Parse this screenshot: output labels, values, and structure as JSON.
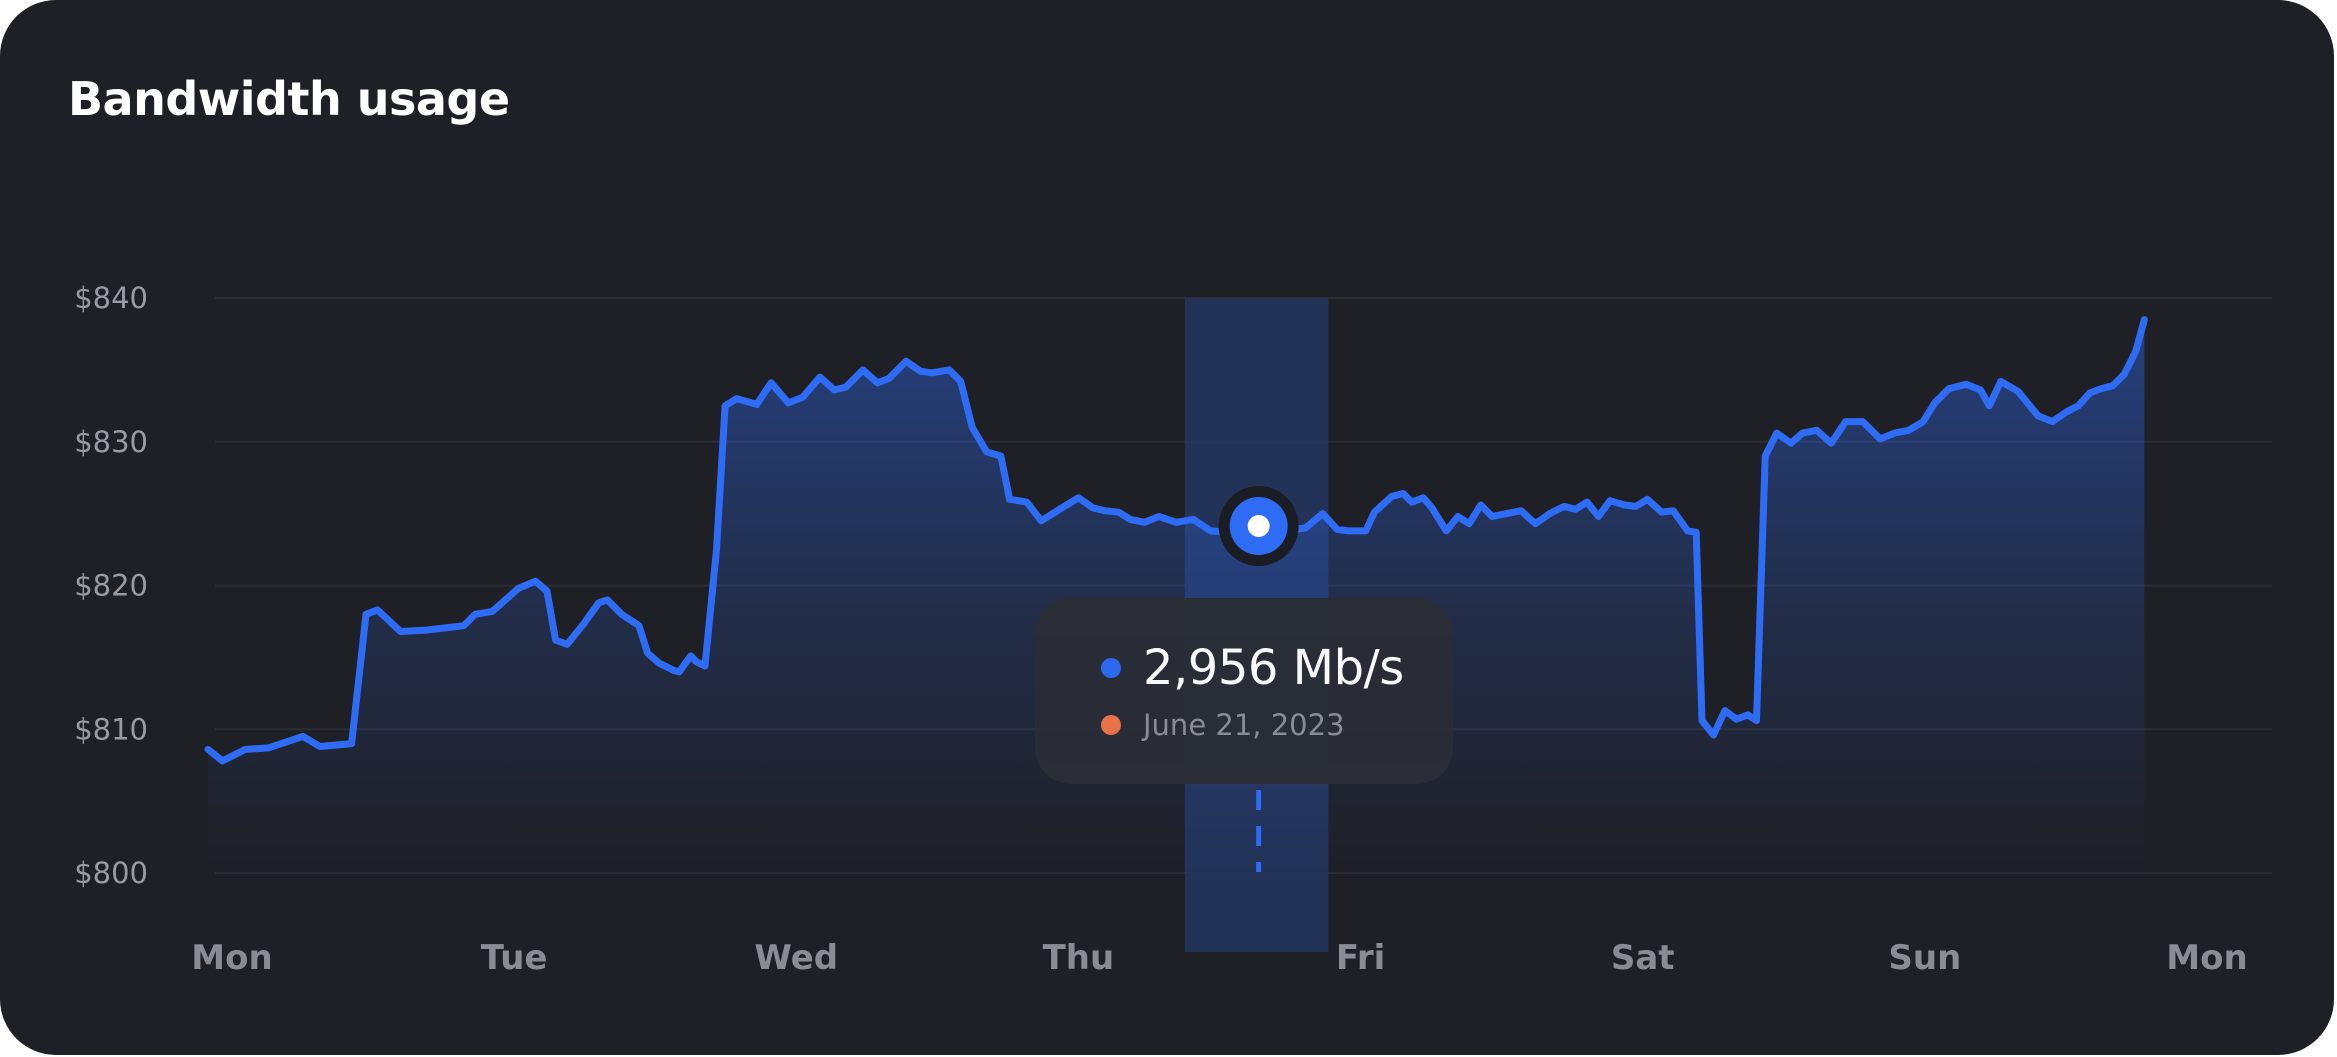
{
  "title": "Bandwidth usage",
  "colors": {
    "background": "#1f2026",
    "line": "#2e6cf6",
    "highlight_band": "#23355e",
    "grid": "#2b2d34",
    "tooltip_value_dot": "#2e6cf6",
    "tooltip_date_dot": "#f0744a"
  },
  "tooltip": {
    "value": "2,956 Mb/s",
    "date": "June 21, 2023"
  },
  "chart_data": {
    "type": "area",
    "title": "Bandwidth usage",
    "y_tick_labels": [
      "$840",
      "$830",
      "$820",
      "$810",
      "$800"
    ],
    "y_ticks": [
      840,
      830,
      820,
      810,
      800
    ],
    "ylim": [
      800,
      840
    ],
    "x_tick_labels": [
      "Mon",
      "Tue",
      "Wed",
      "Thu",
      "Fri",
      "Sat",
      "Sun",
      "Mon"
    ],
    "xlim": [
      0,
      7.2
    ],
    "grid": true,
    "highlight": {
      "x_range": [
        3.4,
        3.9
      ],
      "marker": {
        "x": 3.65,
        "y": 824.2
      }
    },
    "series": [
      {
        "values": [
          [
            0,
            808.6
          ],
          [
            0.05,
            807.8
          ],
          [
            0.13,
            808.6
          ],
          [
            0.21,
            808.7
          ],
          [
            0.33,
            809.5
          ],
          [
            0.39,
            808.8
          ],
          [
            0.5,
            809.0
          ],
          [
            0.55,
            818.0
          ],
          [
            0.59,
            818.3
          ],
          [
            0.67,
            816.8
          ],
          [
            0.76,
            816.9
          ],
          [
            0.89,
            817.2
          ],
          [
            0.93,
            818.0
          ],
          [
            0.99,
            818.2
          ],
          [
            1.08,
            819.8
          ],
          [
            1.14,
            820.3
          ],
          [
            1.18,
            819.6
          ],
          [
            1.21,
            816.2
          ],
          [
            1.25,
            815.9
          ],
          [
            1.31,
            817.4
          ],
          [
            1.36,
            818.8
          ],
          [
            1.39,
            819.0
          ],
          [
            1.44,
            818.0
          ],
          [
            1.5,
            817.2
          ],
          [
            1.53,
            815.3
          ],
          [
            1.57,
            814.6
          ],
          [
            1.62,
            814.1
          ],
          [
            1.64,
            814.0
          ],
          [
            1.68,
            815.1
          ],
          [
            1.7,
            814.7
          ],
          [
            1.73,
            814.4
          ],
          [
            1.77,
            822.5
          ],
          [
            1.8,
            832.5
          ],
          [
            1.84,
            833.0
          ],
          [
            1.91,
            832.6
          ],
          [
            1.96,
            834.1
          ],
          [
            2.02,
            832.7
          ],
          [
            2.07,
            833.1
          ],
          [
            2.13,
            834.5
          ],
          [
            2.18,
            833.6
          ],
          [
            2.22,
            833.8
          ],
          [
            2.28,
            835.0
          ],
          [
            2.33,
            834.1
          ],
          [
            2.37,
            834.4
          ],
          [
            2.43,
            835.6
          ],
          [
            2.48,
            834.9
          ],
          [
            2.52,
            834.8
          ],
          [
            2.58,
            835.0
          ],
          [
            2.62,
            834.2
          ],
          [
            2.66,
            831.0
          ],
          [
            2.71,
            829.3
          ],
          [
            2.76,
            829.0
          ],
          [
            2.79,
            826.0
          ],
          [
            2.85,
            825.8
          ],
          [
            2.9,
            824.5
          ],
          [
            2.94,
            825.0
          ],
          [
            2.98,
            825.5
          ],
          [
            3.03,
            826.1
          ],
          [
            3.08,
            825.4
          ],
          [
            3.12,
            825.2
          ],
          [
            3.17,
            825.1
          ],
          [
            3.21,
            824.6
          ],
          [
            3.26,
            824.4
          ],
          [
            3.31,
            824.8
          ],
          [
            3.37,
            824.4
          ],
          [
            3.43,
            824.6
          ],
          [
            3.49,
            823.8
          ],
          [
            3.55,
            823.7
          ],
          [
            3.59,
            823.8
          ],
          [
            3.63,
            824.2
          ],
          [
            3.68,
            824.3
          ],
          [
            3.73,
            824.2
          ],
          [
            3.78,
            823.9
          ],
          [
            3.82,
            824.0
          ],
          [
            3.88,
            825.0
          ],
          [
            3.93,
            823.9
          ],
          [
            3.97,
            823.8
          ],
          [
            4.03,
            823.8
          ],
          [
            4.06,
            825.1
          ],
          [
            4.12,
            826.2
          ],
          [
            4.16,
            826.4
          ],
          [
            4.19,
            825.8
          ],
          [
            4.23,
            826.1
          ],
          [
            4.26,
            825.4
          ],
          [
            4.31,
            823.8
          ],
          [
            4.35,
            824.8
          ],
          [
            4.39,
            824.3
          ],
          [
            4.43,
            825.6
          ],
          [
            4.47,
            824.8
          ],
          [
            4.52,
            825.0
          ],
          [
            4.57,
            825.2
          ],
          [
            4.62,
            824.3
          ],
          [
            4.67,
            825.0
          ],
          [
            4.72,
            825.5
          ],
          [
            4.76,
            825.3
          ],
          [
            4.8,
            825.8
          ],
          [
            4.84,
            824.8
          ],
          [
            4.88,
            825.9
          ],
          [
            4.93,
            825.6
          ],
          [
            4.97,
            825.5
          ],
          [
            5.01,
            826.0
          ],
          [
            5.06,
            825.1
          ],
          [
            5.1,
            825.2
          ],
          [
            5.15,
            823.8
          ],
          [
            5.18,
            823.7
          ],
          [
            5.2,
            810.6
          ],
          [
            5.24,
            809.6
          ],
          [
            5.28,
            811.3
          ],
          [
            5.32,
            810.7
          ],
          [
            5.36,
            811.0
          ],
          [
            5.39,
            810.6
          ],
          [
            5.42,
            829.0
          ],
          [
            5.46,
            830.6
          ],
          [
            5.51,
            829.9
          ],
          [
            5.55,
            830.6
          ],
          [
            5.6,
            830.8
          ],
          [
            5.65,
            829.9
          ],
          [
            5.7,
            831.4
          ],
          [
            5.76,
            831.4
          ],
          [
            5.82,
            830.2
          ],
          [
            5.87,
            830.6
          ],
          [
            5.92,
            830.8
          ],
          [
            5.97,
            831.4
          ],
          [
            6.01,
            832.7
          ],
          [
            6.06,
            833.7
          ],
          [
            6.12,
            834.0
          ],
          [
            6.17,
            833.6
          ],
          [
            6.2,
            832.5
          ],
          [
            6.24,
            834.2
          ],
          [
            6.3,
            833.5
          ],
          [
            6.37,
            831.8
          ],
          [
            6.42,
            831.4
          ],
          [
            6.47,
            832.1
          ],
          [
            6.51,
            832.5
          ],
          [
            6.55,
            833.4
          ],
          [
            6.59,
            833.7
          ],
          [
            6.63,
            833.9
          ],
          [
            6.67,
            834.7
          ],
          [
            6.71,
            836.3
          ],
          [
            6.74,
            838.5
          ]
        ]
      }
    ]
  }
}
